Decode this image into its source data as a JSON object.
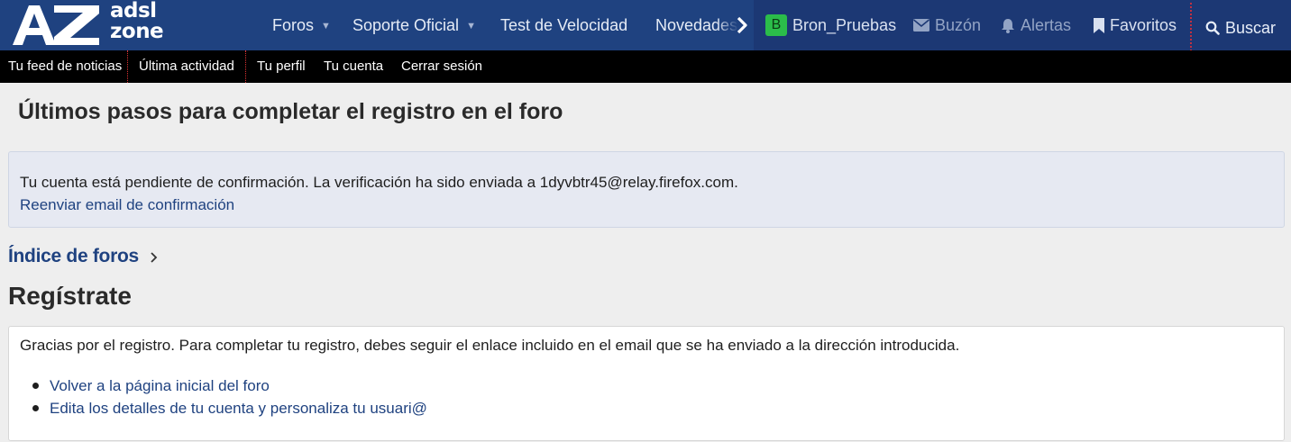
{
  "header": {
    "logo_text_line1": "adsl",
    "logo_text_line2": "zone",
    "nav": [
      {
        "label": "Foros",
        "has_dropdown": true
      },
      {
        "label": "Soporte Oficial",
        "has_dropdown": true
      },
      {
        "label": "Test de Velocidad",
        "has_dropdown": false
      },
      {
        "label": "Novedades",
        "has_dropdown": false
      }
    ],
    "user": {
      "avatar_letter": "B",
      "username": "Bron_Pruebas",
      "inbox_label": "Buzón",
      "alerts_label": "Alertas",
      "bookmarks_label": "Favoritos",
      "search_label": "Buscar"
    },
    "colors": {
      "header_bg": "#1f4280",
      "user_bar_bg": "#1c3874",
      "avatar_bg": "#2bbd4a"
    }
  },
  "subnav": [
    {
      "label": "Tu feed de noticias"
    },
    {
      "label": "Última actividad"
    },
    {
      "label": "Tu perfil"
    },
    {
      "label": "Tu cuenta"
    },
    {
      "label": "Cerrar sesión"
    }
  ],
  "main": {
    "page_title": "Últimos pasos para completar el registro en el foro",
    "notice": {
      "text": "Tu cuenta está pendiente de confirmación. La verificación ha sido enviada a 1dyvbtr45@relay.firefox.com.",
      "link": "Reenviar email de confirmación"
    },
    "breadcrumb": {
      "label": "Índice de foros"
    },
    "section_title": "Regístrate",
    "panel": {
      "text": "Gracias por el registro. Para completar tu registro, debes seguir el enlace incluido en el email que se ha enviado a la dirección introducida.",
      "links": [
        "Volver a la página inicial del foro",
        "Edita los detalles de tu cuenta y personaliza tu usuari@"
      ]
    }
  }
}
